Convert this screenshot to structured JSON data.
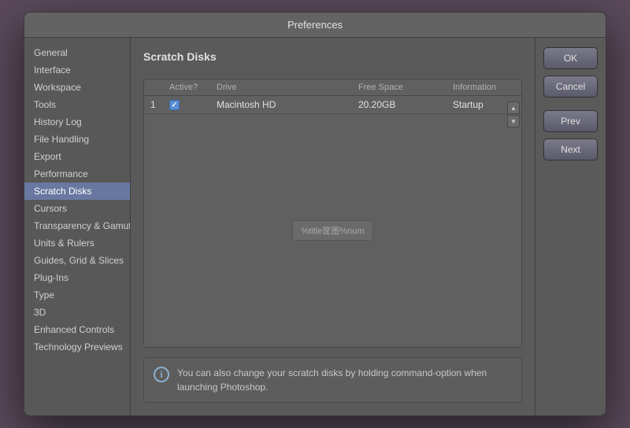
{
  "dialog": {
    "title": "Preferences"
  },
  "sidebar": {
    "items": [
      {
        "label": "General",
        "active": false
      },
      {
        "label": "Interface",
        "active": false
      },
      {
        "label": "Workspace",
        "active": false
      },
      {
        "label": "Tools",
        "active": false
      },
      {
        "label": "History Log",
        "active": false
      },
      {
        "label": "File Handling",
        "active": false
      },
      {
        "label": "Export",
        "active": false
      },
      {
        "label": "Performance",
        "active": false
      },
      {
        "label": "Scratch Disks",
        "active": true
      },
      {
        "label": "Cursors",
        "active": false
      },
      {
        "label": "Transparency & Gamut",
        "active": false
      },
      {
        "label": "Units & Rulers",
        "active": false
      },
      {
        "label": "Guides, Grid & Slices",
        "active": false
      },
      {
        "label": "Plug-Ins",
        "active": false
      },
      {
        "label": "Type",
        "active": false
      },
      {
        "label": "3D",
        "active": false
      },
      {
        "label": "Enhanced Controls",
        "active": false
      },
      {
        "label": "Technology Previews",
        "active": false
      }
    ]
  },
  "main": {
    "section_title": "Scratch Disks",
    "table": {
      "headers": {
        "num": "",
        "active": "Active?",
        "drive": "Drive",
        "free_space": "Free Space",
        "information": "Information"
      },
      "rows": [
        {
          "num": "1",
          "active": true,
          "drive": "Macintosh HD",
          "free_space": "20.20GB",
          "information": "Startup"
        }
      ]
    },
    "placeholder_btn": "%title筐图%num",
    "info_text": "You can also change your scratch disks by holding command-option when launching Photoshop."
  },
  "buttons": {
    "ok": "OK",
    "cancel": "Cancel",
    "prev": "Prev",
    "next": "Next"
  },
  "icons": {
    "info": "i",
    "scroll_up": "▲",
    "scroll_down": "▼"
  }
}
